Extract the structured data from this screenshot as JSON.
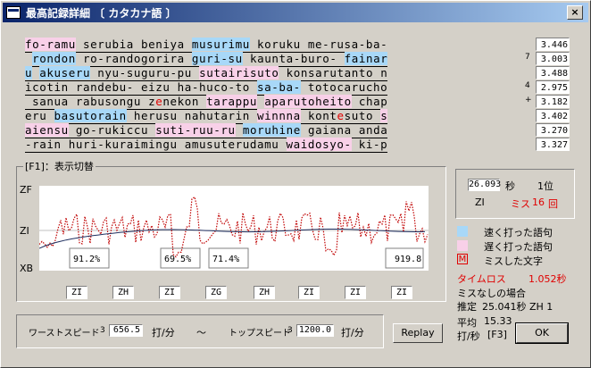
{
  "window": {
    "title": "最高記録詳細 〔 カタカナ語 〕",
    "close": "×"
  },
  "text_lines": [
    {
      "segments": [
        [
          "s",
          "fo-ramu"
        ],
        [
          "n",
          " serubia beniya "
        ],
        [
          "f",
          "musurimu"
        ],
        [
          "n",
          " koruku me-rusa-ba-"
        ]
      ],
      "time": "3.446",
      "marker": ""
    },
    {
      "segments": [
        [
          "n",
          " "
        ],
        [
          "f",
          "rondon"
        ],
        [
          "n",
          " ro-randogorira "
        ],
        [
          "f",
          "guri-su"
        ],
        [
          "n",
          " kaunta-buro- "
        ],
        [
          "f",
          "fainar"
        ]
      ],
      "time": "3.003",
      "marker": "7"
    },
    {
      "segments": [
        [
          "f",
          "u"
        ],
        [
          "n",
          " "
        ],
        [
          "f",
          "akuseru"
        ],
        [
          "n",
          " nyu-suguru-pu "
        ],
        [
          "s",
          "sutairisuto"
        ],
        [
          "n",
          " konsarutanto n"
        ]
      ],
      "time": "3.488",
      "marker": ""
    },
    {
      "segments": [
        [
          "n",
          "icotin randebu- eizu ha-huco-to "
        ],
        [
          "f",
          "sa-ba-"
        ],
        [
          "n",
          " totocarucho"
        ]
      ],
      "time": "2.975",
      "marker": "4"
    },
    {
      "segments": [
        [
          "n",
          " sanua rabusongu z"
        ],
        [
          "m",
          "e"
        ],
        [
          "n",
          "nekon "
        ],
        [
          "s",
          "tarappu"
        ],
        [
          "n",
          " "
        ],
        [
          "s",
          "aparutoheito"
        ],
        [
          "n",
          " chap"
        ]
      ],
      "time": "3.182",
      "marker": "+"
    },
    {
      "segments": [
        [
          "n",
          "eru "
        ],
        [
          "f",
          "basutorain"
        ],
        [
          "n",
          " herusu nahutarin "
        ],
        [
          "s",
          "winnna"
        ],
        [
          "n",
          " kont"
        ],
        [
          "m",
          "e"
        ],
        [
          "n",
          "suto "
        ],
        [
          "s",
          "s"
        ]
      ],
      "time": "3.402",
      "marker": ""
    },
    {
      "segments": [
        [
          "s",
          "aiensu"
        ],
        [
          "n",
          " go-rukiccu "
        ],
        [
          "s",
          "suti-ruu-ru"
        ],
        [
          "n",
          " "
        ],
        [
          "f",
          "moruhine"
        ],
        [
          "n",
          " gaiana anda"
        ]
      ],
      "time": "3.270",
      "marker": ""
    },
    {
      "segments": [
        [
          "n",
          "-rain huri-kuraimingu amusuterudamu "
        ],
        [
          "s",
          "waidosyo-"
        ],
        [
          "n",
          " ki-p"
        ]
      ],
      "time": "3.327",
      "marker": ""
    }
  ],
  "graph": {
    "title": "[F1]：表示切替",
    "y_labels": {
      "top": "ZF",
      "mid": "ZI",
      "bottom": "XB"
    },
    "percentages": [
      "91.2%",
      "69.5%",
      "71.4%",
      "919.8"
    ],
    "zone_labels": [
      "ZI",
      "ZH",
      "ZI",
      "ZG",
      "ZH",
      "ZI",
      "ZI",
      "ZI"
    ],
    "colors": {
      "line": "#c00000",
      "trend": "#203060"
    }
  },
  "rank": {
    "time": "26.093",
    "time_unit": "秒",
    "rank": "1位",
    "level": "ZI",
    "miss_label": "ミス",
    "miss_count": "16",
    "miss_unit": "回"
  },
  "legend": [
    {
      "label": "速く打った語句",
      "color": "#a8d8f8"
    },
    {
      "label": "遅く打った語句",
      "color": "#f8d0e8"
    },
    {
      "label": "ミスした文字",
      "symbol": "M"
    }
  ],
  "loss": {
    "label": "タイムロス",
    "value": "1.052秒"
  },
  "no_miss": {
    "label": "ミスなしの場合",
    "estimate_label": "推定",
    "estimate_value": "25.041秒 ZH 1"
  },
  "average": {
    "label": "平均",
    "value": "15.33",
    "unit": "打/秒",
    "key": "[F3]"
  },
  "speeds": {
    "worst_label": "ワーストスピード",
    "worst_marker": "3",
    "worst_value": "656.5",
    "unit": "打/分",
    "tilde": "〜",
    "top_label": "トップスピード",
    "top_marker": "3",
    "top_value": "1200.0"
  },
  "buttons": {
    "replay": "Replay",
    "ok": "OK"
  }
}
